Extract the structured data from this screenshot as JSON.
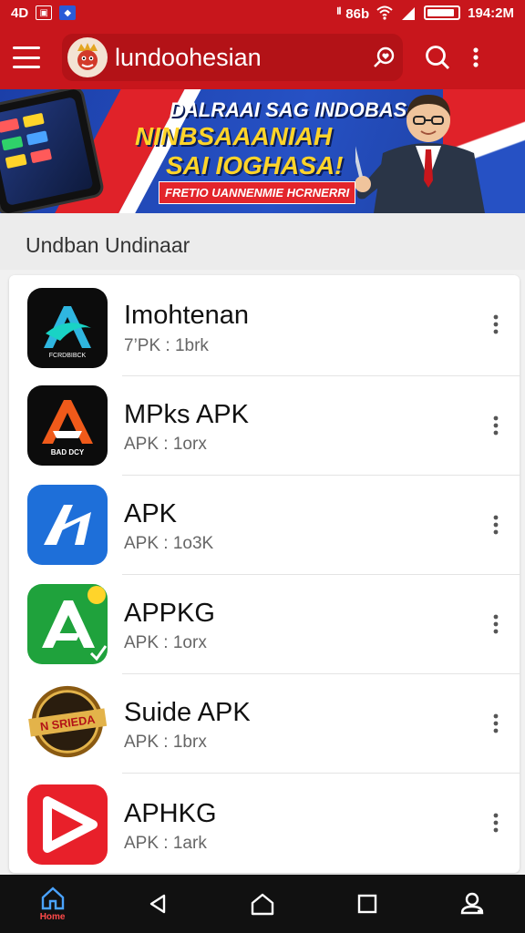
{
  "status_bar": {
    "left_text": "4D",
    "right_text": "ᅵᅵ 86b",
    "time": "194:2M",
    "battery_level": 0.9
  },
  "app_bar": {
    "title": "lundoohesian"
  },
  "banner": {
    "line1": "DALRAAI SAG INDOBASAI",
    "line2": "NINBSAAANIAH",
    "line3": "SAI IOGHASA!",
    "subline": "FRETIO UANNENMIE HCRNERRI"
  },
  "section": {
    "title": "Undban Undinaar"
  },
  "apps": [
    {
      "name": "Imohtenan",
      "sub": "7’PK : 1brk",
      "icon": "stylized-a-icon",
      "bg": "#0c0c0c",
      "accent": "#2fb6e0",
      "tag": "FCRDBIBCK"
    },
    {
      "name": "MPks APK",
      "sub": "APK : 1orx",
      "icon": "stylized-a-icon",
      "bg": "#0c0c0c",
      "accent": "#f05a1a",
      "tag": "BAD DCY"
    },
    {
      "name": "APK",
      "sub": "APK : 1o3K",
      "icon": "stylized-a-icon",
      "bg": "#1e6fd9",
      "accent": "#ffffff",
      "tag": ""
    },
    {
      "name": "APPKG",
      "sub": "APK : 1orx",
      "icon": "stylized-a-icon",
      "bg": "#1fa23c",
      "accent": "#ffffff",
      "tag": ""
    },
    {
      "name": "Suide APK",
      "sub": "APK : 1brx",
      "icon": "seal-badge-icon",
      "bg": "#ffffff",
      "accent": "#8a5a12",
      "tag": "N SRIEDA"
    },
    {
      "name": "APHKG",
      "sub": "APK : 1ark",
      "icon": "play-triangle-icon",
      "bg": "#e8202a",
      "accent": "#ffffff",
      "tag": ""
    }
  ],
  "bottom_nav": {
    "home_label": "Home"
  },
  "colors": {
    "primary": "#c8161c",
    "banner_blue": "#2651c4",
    "nav_bg": "#111111"
  }
}
